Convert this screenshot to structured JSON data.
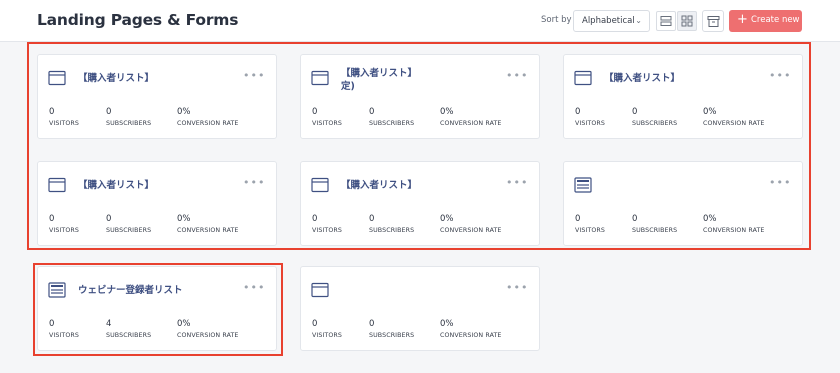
{
  "header": {
    "title": "Landing Pages & Forms",
    "sort_label": "Sort by",
    "sort_value": "Alphabetical",
    "create_label": "Create new",
    "create_color": "#ee6f70"
  },
  "stat_labels": {
    "visitors": "VISITORS",
    "subscribers": "SUBSCRIBERS",
    "conversion": "CONVERSION RATE"
  },
  "cards": [
    {
      "title": "【購入者リスト】",
      "icon": "form-icon",
      "visitors": "0",
      "subscribers": "0",
      "conversion": "0%"
    },
    {
      "title": "【購入者リスト】\n定)",
      "icon": "form-icon",
      "visitors": "0",
      "subscribers": "0",
      "conversion": "0%"
    },
    {
      "title": "【購入者リスト】",
      "icon": "form-icon",
      "visitors": "0",
      "subscribers": "0",
      "conversion": "0%"
    },
    {
      "title": "【購入者リスト】",
      "icon": "form-icon",
      "visitors": "0",
      "subscribers": "0",
      "conversion": "0%"
    },
    {
      "title": "【購入者リスト】",
      "icon": "form-icon",
      "visitors": "0",
      "subscribers": "0",
      "conversion": "0%"
    },
    {
      "title": "",
      "icon": "landing-page-icon",
      "visitors": "0",
      "subscribers": "0",
      "conversion": "0%"
    },
    {
      "title": "ウェビナー登録者リスト",
      "icon": "landing-page-icon",
      "visitors": "0",
      "subscribers": "4",
      "conversion": "0%"
    },
    {
      "title": "",
      "icon": "form-icon",
      "visitors": "0",
      "subscribers": "0",
      "conversion": "0%"
    }
  ],
  "highlight_color": "#e8412f"
}
